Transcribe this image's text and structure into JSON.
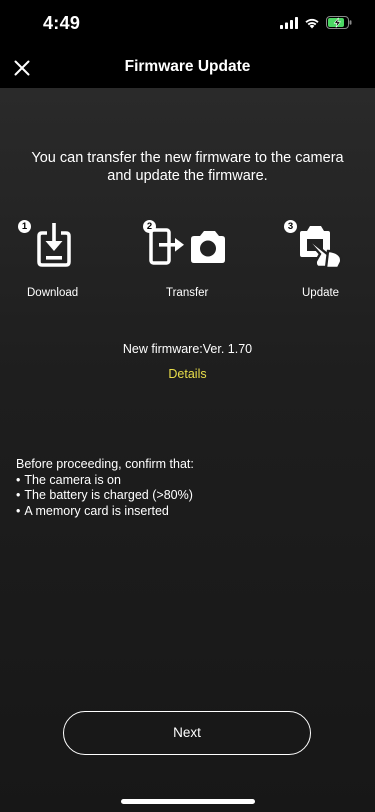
{
  "status_bar": {
    "time": "4:49",
    "icons": [
      "signal-bars-icon",
      "wifi-icon",
      "battery-charging-icon"
    ],
    "battery_color": "#4cd964"
  },
  "header": {
    "title": "Firmware Update",
    "close_icon": "close-icon"
  },
  "intro": {
    "line1": "You can transfer the new firmware to the camera",
    "line2": "and update the firmware."
  },
  "steps": [
    {
      "number": "1",
      "label": "Download",
      "icon": "download-icon"
    },
    {
      "number": "2",
      "label": "Transfer",
      "icon": "phone-to-camera-icon"
    },
    {
      "number": "3",
      "label": "Update",
      "icon": "camera-tap-icon"
    }
  ],
  "firmware": {
    "version_text": "New firmware:Ver. 1.70",
    "details_label": "Details",
    "details_color": "#e9de4a"
  },
  "checklist": {
    "heading": "Before proceeding, confirm that:",
    "items": [
      "The camera is on",
      "The battery is charged (>80%)",
      "A memory card is inserted"
    ]
  },
  "footer": {
    "next_label": "Next"
  }
}
